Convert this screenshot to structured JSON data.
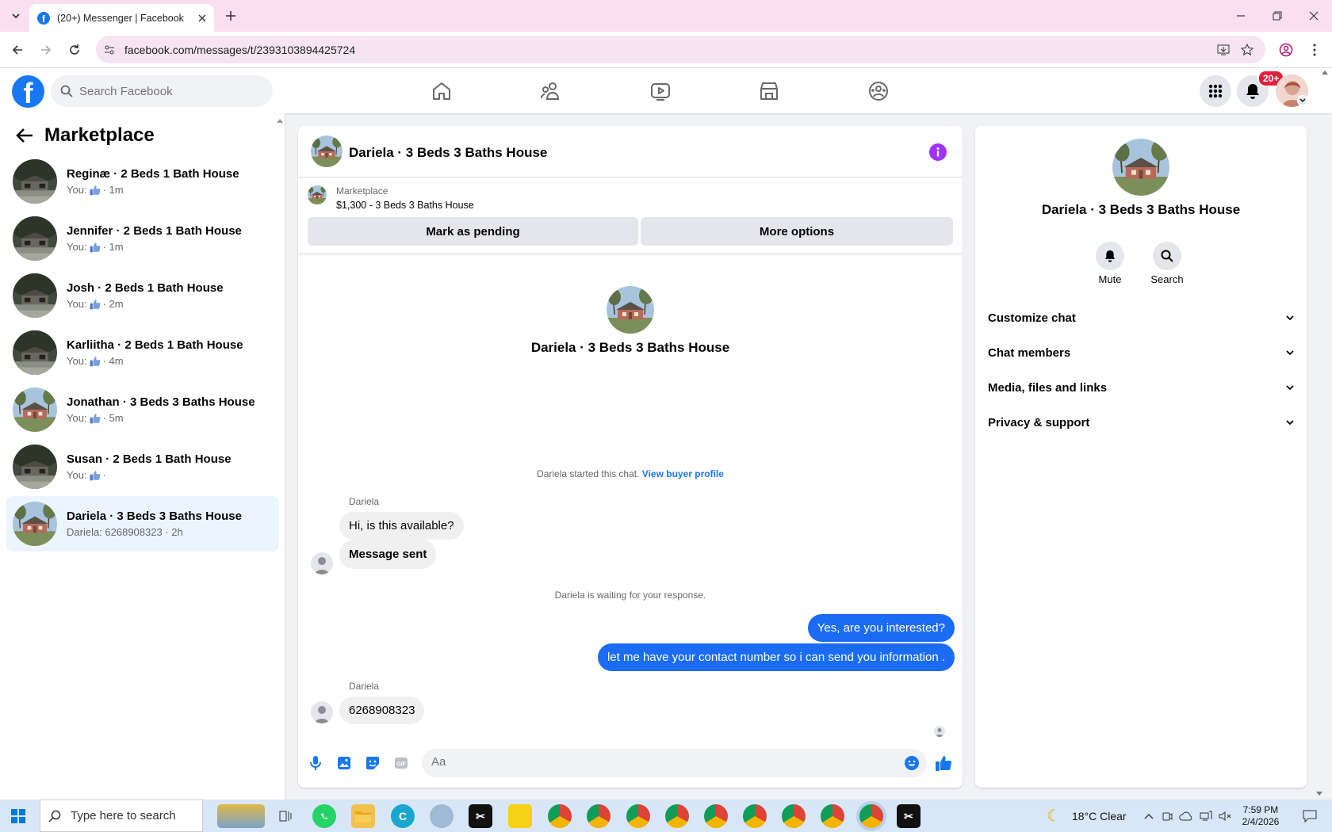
{
  "browser": {
    "tab_title": "(20+) Messenger | Facebook",
    "url": "facebook.com/messages/t/2393103894425724"
  },
  "header": {
    "search_placeholder": "Search Facebook",
    "notification_badge": "20+"
  },
  "sidebar": {
    "title": "Marketplace",
    "conversations": [
      {
        "name": "Reginæ · 2 Beds 1 Bath House",
        "prefix": "You:",
        "time": "· 1m",
        "thumb": "dark"
      },
      {
        "name": "Jennifer · 2 Beds 1 Bath House",
        "prefix": "You:",
        "time": "· 1m",
        "thumb": "dark"
      },
      {
        "name": "Josh · 2 Beds 1 Bath House",
        "prefix": "You:",
        "time": "· 2m",
        "thumb": "dark"
      },
      {
        "name": "Karliitha · 2 Beds 1 Bath House",
        "prefix": "You:",
        "time": "· 4m",
        "thumb": "dark"
      },
      {
        "name": "Jonathan · 3 Beds 3 Baths House",
        "prefix": "You:",
        "time": "· 5m",
        "thumb": "house"
      },
      {
        "name": "Susan · 2 Beds 1 Bath House",
        "prefix": "You:",
        "time": "·",
        "thumb": "dark"
      },
      {
        "name": "Dariela · 3 Beds 3 Baths House",
        "preview": "Dariela: 6268908323 · 2h",
        "thumb": "house",
        "active": true
      }
    ]
  },
  "chat": {
    "title": "Dariela · 3 Beds 3 Baths House",
    "marketplace_label": "Marketplace",
    "listing": "$1,300 - 3 Beds 3 Baths House",
    "mark_pending": "Mark as pending",
    "more_options": "More options",
    "intro_name": "Dariela · 3 Beds 3 Baths House",
    "started_text": "Dariela started this chat.",
    "view_buyer_profile": "View buyer profile",
    "waiting_text": "Dariela is waiting for your response.",
    "composer_placeholder": "Aa",
    "messages": {
      "sender1": "Dariela",
      "m1": "Hi, is this available?",
      "m2": "Message sent",
      "m3": "Yes, are you interested?",
      "m4": "let me have your contact number so i can send you information .",
      "sender2": "Dariela",
      "m5": "6268908323"
    }
  },
  "details": {
    "name": "Dariela · 3 Beds 3 Baths House",
    "mute": "Mute",
    "search": "Search",
    "sections": [
      "Customize chat",
      "Chat members",
      "Media, files and links",
      "Privacy & support"
    ]
  },
  "taskbar": {
    "search_placeholder": "Type here to search",
    "weather": "18°C  Clear",
    "time": "7:59 PM",
    "date": "2/4/2026"
  },
  "colors": {
    "accent": "#1877f2",
    "outgoing": "#1b6cf2",
    "badge": "#e41e3f",
    "info": "#a033ff"
  }
}
